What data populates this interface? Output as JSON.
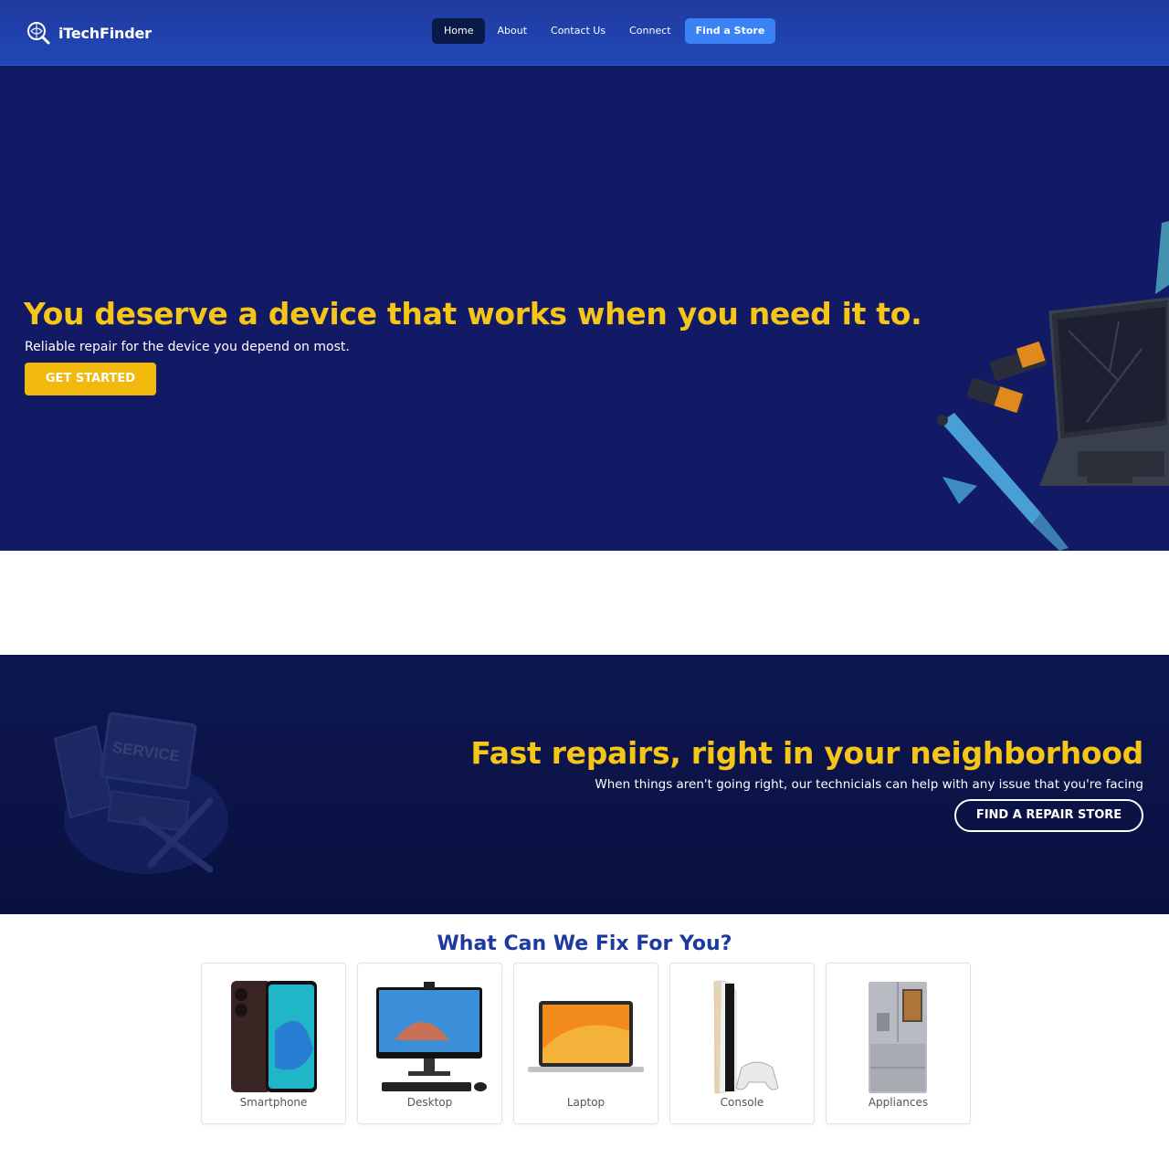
{
  "brand": {
    "name": "iTechFinder",
    "logo_icon": "magnifier-globe-icon"
  },
  "nav": {
    "items": [
      {
        "label": "Home",
        "active": true
      },
      {
        "label": "About",
        "active": false
      },
      {
        "label": "Contact Us",
        "active": false
      },
      {
        "label": "Connect",
        "active": false
      }
    ],
    "cta_label": "Find a Store"
  },
  "hero": {
    "title": "You deserve a device that works when you need it to.",
    "subtitle": "Reliable repair for the device you depend on most.",
    "button_label": "GET STARTED"
  },
  "banner": {
    "title": "Fast repairs, right in your neighborhood",
    "subtitle": "When things aren't going right, our technicials can help with any issue that you're facing",
    "button_label": "FIND A REPAIR STORE",
    "art_label": "SERVICE"
  },
  "fix": {
    "title": "What Can We Fix For You?",
    "items": [
      {
        "label": "Smartphone",
        "icon": "smartphone-icon"
      },
      {
        "label": "Desktop",
        "icon": "desktop-icon"
      },
      {
        "label": "Laptop",
        "icon": "laptop-icon"
      },
      {
        "label": "Console",
        "icon": "console-icon"
      },
      {
        "label": "Appliances",
        "icon": "refrigerator-icon"
      }
    ]
  },
  "colors": {
    "nav_bg": "#2148b8",
    "hero_bg": "#121a66",
    "accent_yellow": "#f5c518",
    "cta_blue": "#3b82f6",
    "heading_blue": "#1e3a9e"
  }
}
